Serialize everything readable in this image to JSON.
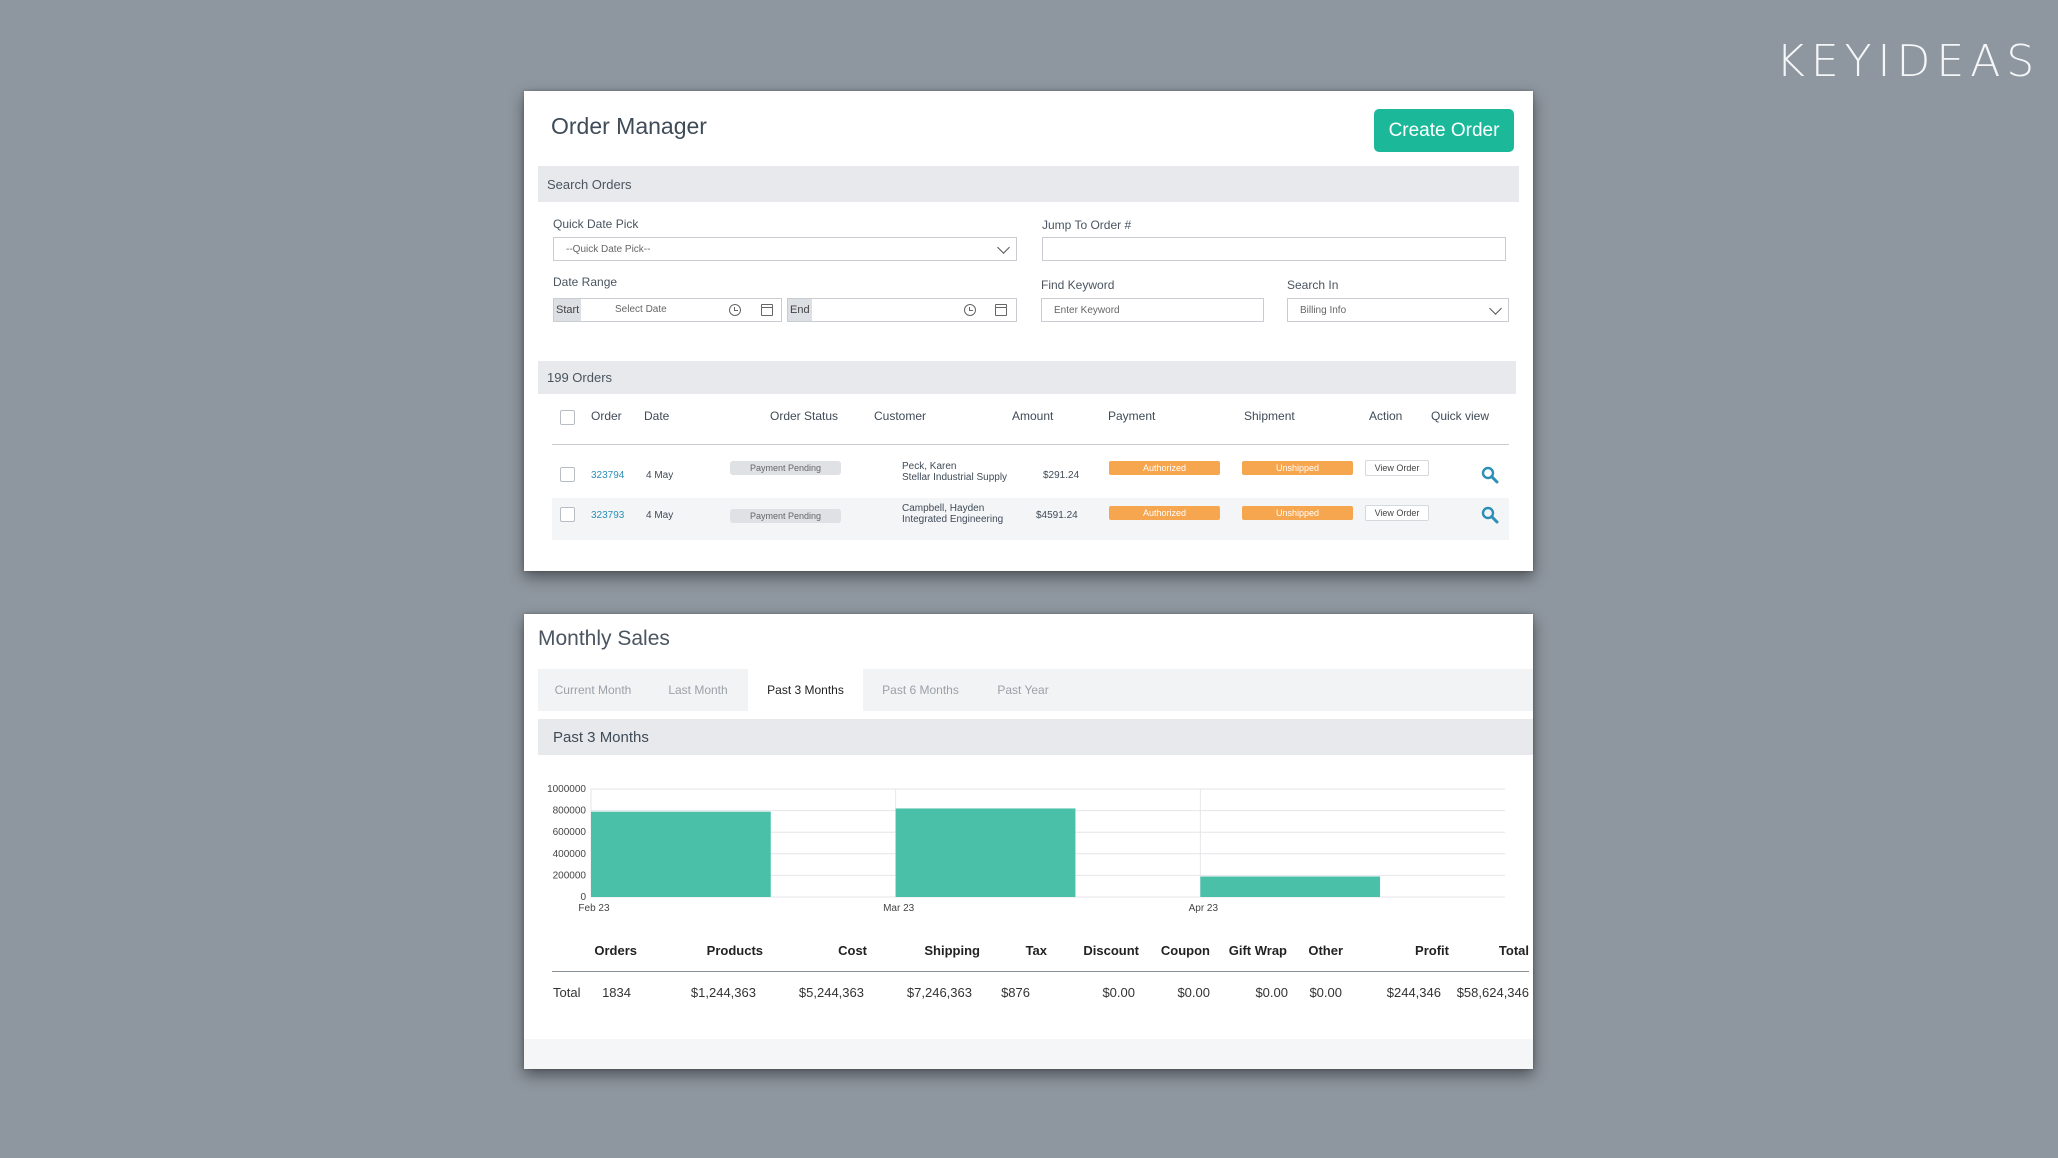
{
  "brand": "KEYIDEAS",
  "order_manager": {
    "title": "Order Manager",
    "create_button": "Create Order",
    "search_section_title": "Search Orders",
    "quick_date_label": "Quick Date Pick",
    "quick_date_value": "--Quick Date Pick--",
    "jump_label": "Jump To Order #",
    "jump_value": "",
    "date_range_label": "Date Range",
    "start_tag": "Start",
    "start_placeholder": "Select Date",
    "end_tag": "End",
    "end_placeholder": "",
    "keyword_label": "Find Keyword",
    "keyword_placeholder": "Enter Keyword",
    "search_in_label": "Search In",
    "search_in_value": "Billing Info",
    "orders_count": "199 Orders",
    "columns": [
      "Order",
      "Date",
      "Order Status",
      "Customer",
      "Amount",
      "Payment",
      "Shipment",
      "Action",
      "Quick view"
    ],
    "rows": [
      {
        "order": "323794",
        "date": "4 May",
        "status": "Payment Pending",
        "customer_name": "Peck, Karen",
        "customer_company": "Stellar Industrial Supply",
        "amount": "$291.24",
        "payment": "Authorized",
        "shipment": "Unshipped",
        "action": "View Order"
      },
      {
        "order": "323793",
        "date": "4 May",
        "status": "Payment Pending",
        "customer_name": "Campbell, Hayden",
        "customer_company": "Integrated Engineering",
        "amount": "$4591.24",
        "payment": "Authorized",
        "shipment": "Unshipped",
        "action": "View Order"
      }
    ]
  },
  "monthly_sales": {
    "title": "Monthly Sales",
    "tabs": [
      "Current Month",
      "Last Month",
      "Past 3 Months",
      "Past 6 Months",
      "Past Year"
    ],
    "active_tab": "Past 3 Months",
    "section_title": "Past 3 Months",
    "summary_headers": [
      "Orders",
      "Products",
      "Cost",
      "Shipping",
      "Tax",
      "Discount",
      "Coupon",
      "Gift Wrap",
      "Other",
      "Profit",
      "Total"
    ],
    "summary_row_label": "Total",
    "summary_values": [
      "1834",
      "$1,244,363",
      "$5,244,363",
      "$7,246,363",
      "$876",
      "$0.00",
      "$0.00",
      "$0.00",
      "$0.00",
      "$244,346",
      "$58,624,346"
    ]
  },
  "chart_data": {
    "type": "bar",
    "categories": [
      "Feb 23",
      "Mar 23",
      "Apr 23"
    ],
    "values": [
      790000,
      820000,
      190000
    ],
    "ylim": [
      0,
      1000000
    ],
    "yticks": [
      0,
      200000,
      400000,
      600000,
      800000,
      1000000
    ],
    "grid": true,
    "bar_color": "#4bc0a8"
  },
  "colors": {
    "background": "#8e969f",
    "accent": "#1bb99a",
    "link": "#2c8fb8",
    "orange_badge": "#f7a650",
    "search_icon": "#2c8fb8"
  },
  "icons": {
    "quick_view": "search-icon",
    "date_clock": "clock-icon",
    "date_calendar": "calendar-icon",
    "dropdown": "chevron-down-icon"
  }
}
